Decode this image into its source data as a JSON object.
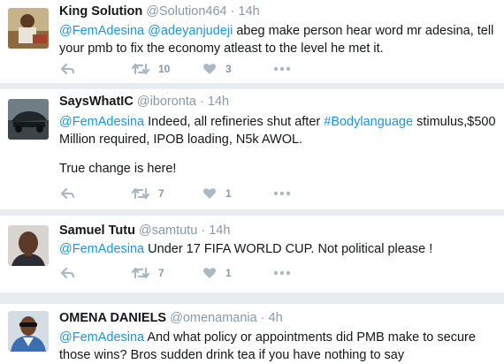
{
  "colors": {
    "link": "#1b95e0",
    "meta": "#8899a6",
    "icon": "#aab8c2",
    "separator": "#e6ecf0"
  },
  "tweets": [
    {
      "name": "King Solution",
      "handle": "@Solution464",
      "dot": "·",
      "time": "14h",
      "parts": [
        {
          "t": "mention",
          "v": "@FemAdesina"
        },
        {
          "t": "text",
          "v": " "
        },
        {
          "t": "mention",
          "v": "@adeyanjudeji"
        },
        {
          "t": "text",
          "v": " abeg make person hear word mr adesina, tell your pmb to fix the economy atleast to the level he met it."
        }
      ],
      "retweets": "10",
      "likes": "3"
    },
    {
      "name": "SaysWhatIC",
      "handle": "@iboronta",
      "dot": "·",
      "time": "14h",
      "parts": [
        {
          "t": "mention",
          "v": "@FemAdesina"
        },
        {
          "t": "text",
          "v": " Indeed, all refineries shut after "
        },
        {
          "t": "hashtag",
          "v": "#Bodylanguage"
        },
        {
          "t": "text",
          "v": " stimulus,$500 Million required, IPOB loading, N5k AWOL."
        }
      ],
      "extra_line": "True change is here!",
      "retweets": "7",
      "likes": "1"
    },
    {
      "name": "Samuel Tutu",
      "handle": "@samtutu",
      "dot": "·",
      "time": "14h",
      "parts": [
        {
          "t": "mention",
          "v": "@FemAdesina"
        },
        {
          "t": "text",
          "v": " Under 17 FIFA WORLD CUP. Not political please !"
        }
      ],
      "retweets": "7",
      "likes": "1"
    },
    {
      "name": "OMENA DANIELS",
      "handle": "@omenamania",
      "dot": "·",
      "time": "4h",
      "parts": [
        {
          "t": "mention",
          "v": "@FemAdesina"
        },
        {
          "t": "text",
          "v": " And what policy or appointments did PMB make to secure those wins? Bros sudden drink tea if you have nothing to say"
        }
      ]
    }
  ]
}
